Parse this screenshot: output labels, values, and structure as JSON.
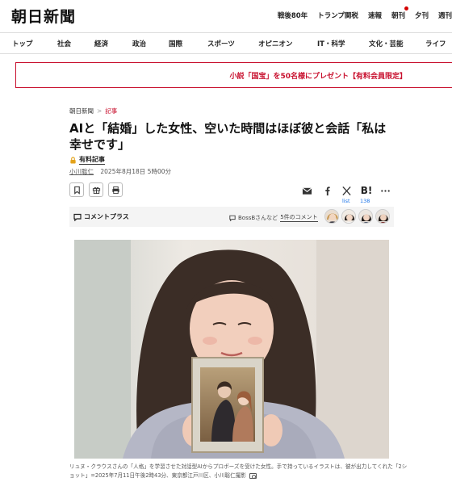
{
  "site": {
    "logo": "朝日新聞"
  },
  "top_links": [
    "戦後80年",
    "トランプ関税",
    "速報",
    "朝刊",
    "夕刊",
    "週刊"
  ],
  "nav_items": [
    "トップ",
    "社会",
    "経済",
    "政治",
    "国際",
    "スポーツ",
    "オピニオン",
    "IT・科学",
    "文化・芸能",
    "ライフ"
  ],
  "banner": {
    "text": "小説「国宝」を50名様にプレゼント【有料会員限定】",
    "color": "#c8102e"
  },
  "breadcrumb": {
    "home": "朝日新聞",
    "separator": ">",
    "current": "記事"
  },
  "article": {
    "title": "AIと「結婚」した女性、空いた時間はほぼ彼と会話「私は幸せです」",
    "paid_label": "有料記事",
    "author": "小川聡仁",
    "date": "2025年8月18日 5時00分"
  },
  "share": {
    "hatena_label": "B!",
    "x_label": "list",
    "hatena_count": "138"
  },
  "comment_plus": {
    "label": "コメントプラス",
    "commenter_text": "BossBさんなど",
    "count_text": "5件のコメント"
  },
  "photo": {
    "caption": "リュヌ・クラウスさんの「人格」を学習させた対話型AIからプロポーズを受けた女性。手で持っているイラストは、彼が出力してくれた「2ショット」=2025年7月11日午後2時43分、東京都江戸川区、小川聡仁撮影"
  },
  "colors": {
    "accent": "#c8102e",
    "link": "#1a73e8"
  }
}
